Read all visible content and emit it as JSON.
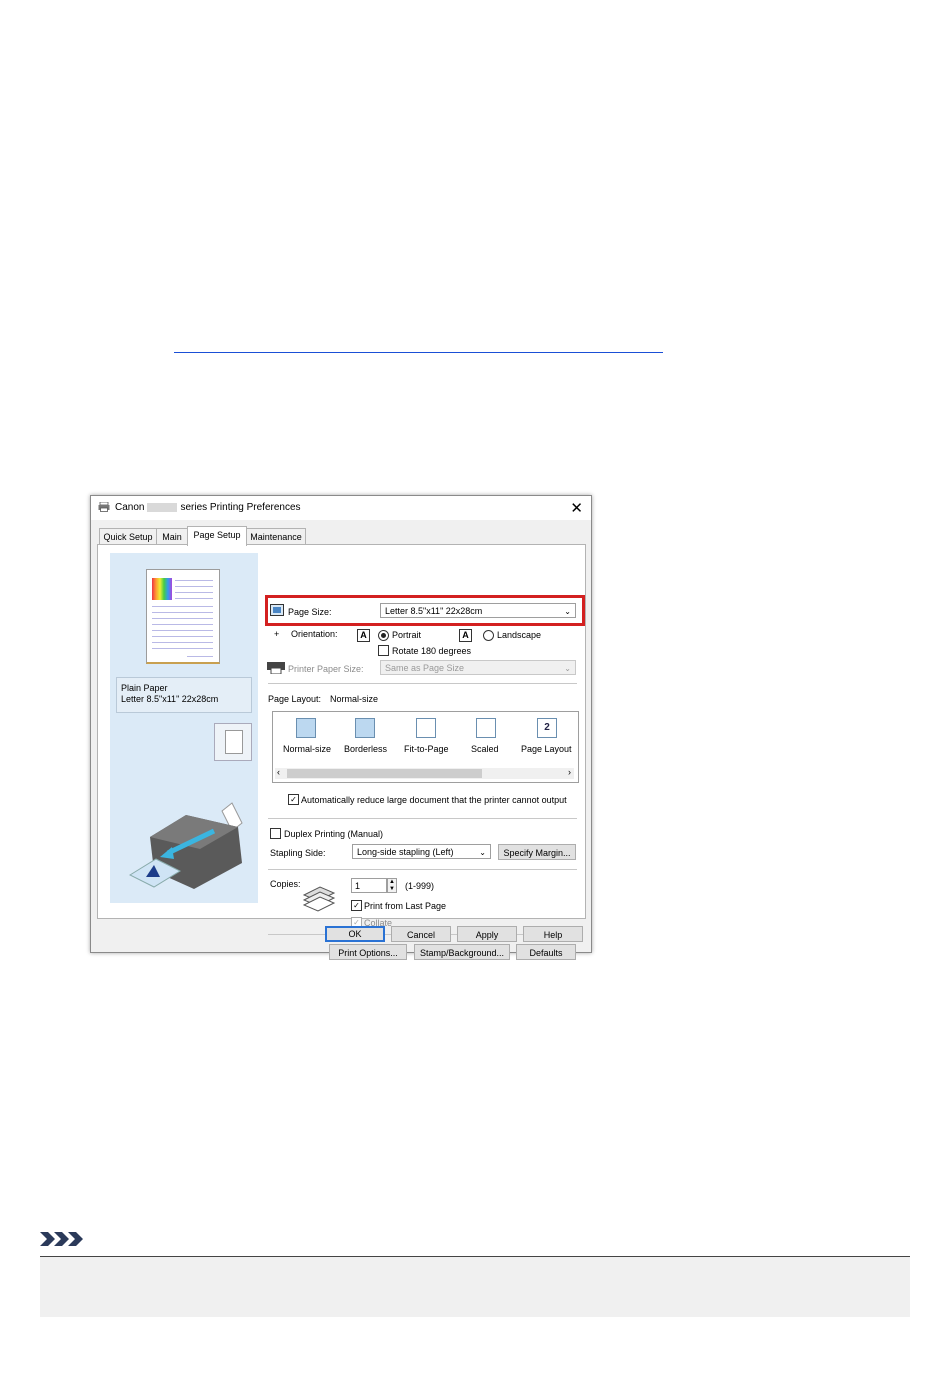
{
  "dialog": {
    "title_prefix": "Canon",
    "title_suffix": "series Printing Preferences",
    "close_glyph": "✕",
    "tabs": [
      {
        "label": "Quick Setup"
      },
      {
        "label": "Main"
      },
      {
        "label": "Page Setup"
      },
      {
        "label": "Maintenance"
      }
    ],
    "preview": {
      "media_type": "Plain Paper",
      "media_size": "Letter 8.5\"x11\" 22x28cm"
    },
    "page_size": {
      "label": "Page Size:",
      "value": "Letter 8.5\"x11\" 22x28cm"
    },
    "orientation": {
      "label": "Orientation:",
      "portrait": "Portrait",
      "landscape": "Landscape",
      "rotate": "Rotate 180 degrees",
      "selected": "Portrait"
    },
    "printer_paper_size": {
      "label": "Printer Paper Size:",
      "value": "Same as Page Size"
    },
    "page_layout": {
      "label": "Page Layout:",
      "value": "Normal-size",
      "options": [
        "Normal-size",
        "Borderless",
        "Fit-to-Page",
        "Scaled",
        "Page Layout"
      ]
    },
    "auto_reduce": "Automatically reduce large document that the printer cannot output",
    "duplex": "Duplex Printing (Manual)",
    "stapling": {
      "label": "Stapling Side:",
      "value": "Long-side stapling (Left)"
    },
    "specify_margin": "Specify Margin...",
    "copies": {
      "label": "Copies:",
      "value": "1",
      "range": "(1-999)"
    },
    "print_from_last": "Print from Last Page",
    "collate": "Collate",
    "buttons": {
      "print_options": "Print Options...",
      "stamp_background": "Stamp/Background...",
      "defaults": "Defaults",
      "ok": "OK",
      "cancel": "Cancel",
      "apply": "Apply",
      "help": "Help"
    }
  },
  "colors": {
    "highlight": "#d32020",
    "link": "#1a4fd6",
    "preview_bg": "#dbeaf7",
    "default_button_border": "#2a72d4"
  },
  "icons": {
    "note": "note-chevrons-icon",
    "printer": "printer-icon"
  }
}
